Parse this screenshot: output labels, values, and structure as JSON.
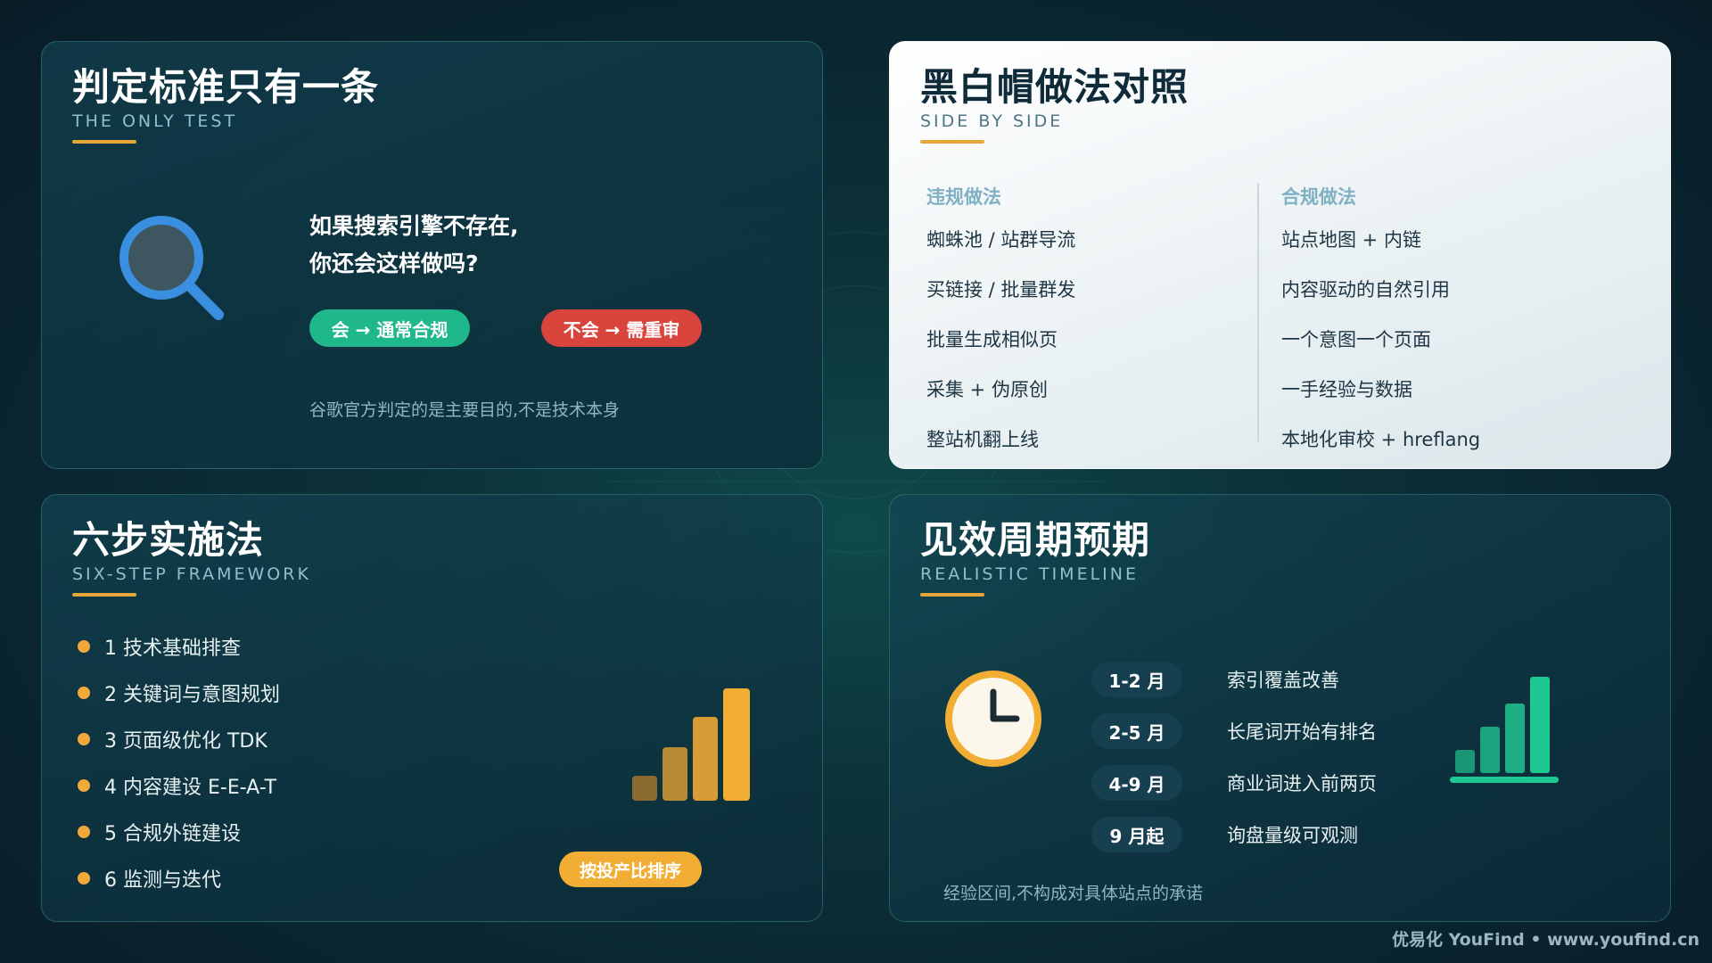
{
  "test": {
    "title": "判定标准只有一条",
    "subtitle": "THE ONLY TEST",
    "question_line1": "如果搜索引擎不存在,",
    "question_line2": "你还会这样做吗?",
    "yes_pill": "会 → 通常合规",
    "no_pill": "不会 → 需重审",
    "note": "谷歌官方判定的是主要目的,不是技术本身",
    "icon": "magnifier-icon"
  },
  "compare": {
    "title": "黑白帽做法对照",
    "subtitle": "SIDE BY SIDE",
    "left_head": "违规做法",
    "right_head": "合规做法",
    "left_items": [
      "蜘蛛池 / 站群导流",
      "买链接 / 批量群发",
      "批量生成相似页",
      "采集 + 伪原创",
      "整站机翻上线"
    ],
    "right_items": [
      "站点地图 + 内链",
      "内容驱动的自然引用",
      "一个意图一个页面",
      "一手经验与数据",
      "本地化审校 + hreflang"
    ]
  },
  "steps": {
    "title": "六步实施法",
    "subtitle": "SIX-STEP FRAMEWORK",
    "items": [
      "1 技术基础排查",
      "2 关键词与意图规划",
      "3 页面级优化 TDK",
      "4 内容建设 E-E-A-T",
      "5 合规外链建设",
      "6 监测与迭代"
    ],
    "pill": "按投产比排序",
    "icon": "bar-chart-icon"
  },
  "timeline": {
    "title": "见效周期预期",
    "subtitle": "REALISTIC TIMELINE",
    "rows": [
      {
        "badge": "1-2 月",
        "text": "索引覆盖改善"
      },
      {
        "badge": "2-5 月",
        "text": "长尾词开始有排名"
      },
      {
        "badge": "4-9 月",
        "text": "商业词进入前两页"
      },
      {
        "badge": "9 月起",
        "text": "询盘量级可观测"
      }
    ],
    "note": "经验区间,不构成对具体站点的承诺",
    "icons": [
      "clock-icon",
      "growth-chart-icon"
    ]
  },
  "footer": "优易化 YouFind • www.youfind.cn",
  "colors": {
    "accent": "#e5a73a",
    "green": "#1fb88a",
    "red": "#d9443c",
    "orange": "#f2ad34"
  }
}
